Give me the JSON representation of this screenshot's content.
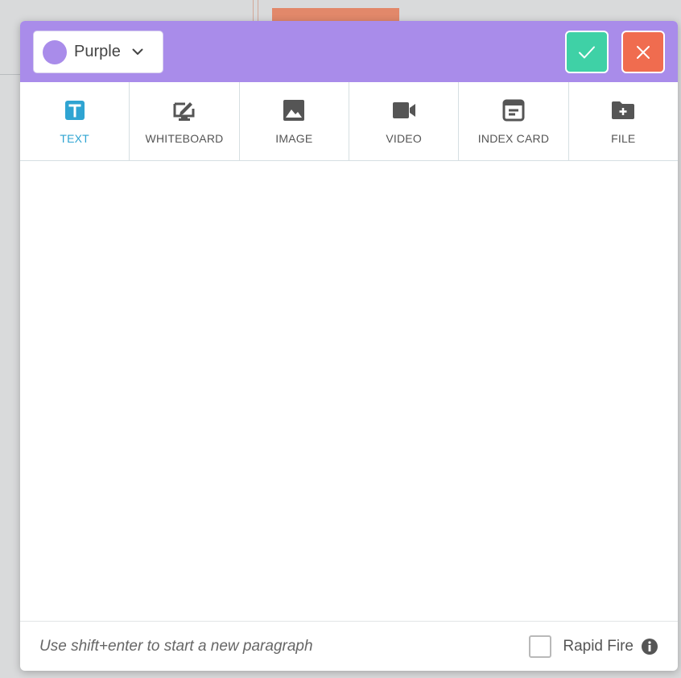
{
  "header": {
    "color_select": {
      "label": "Purple",
      "color": "#a98cea",
      "icon": "chevron-down-icon"
    },
    "confirm_button": {
      "icon": "check-icon",
      "color": "#3fd1a6"
    },
    "close_button": {
      "icon": "close-icon",
      "color": "#f06c4f"
    }
  },
  "toolbar": {
    "tools": [
      {
        "label": "TEXT",
        "icon": "text-icon",
        "active": true
      },
      {
        "label": "WHITEBOARD",
        "icon": "whiteboard-icon"
      },
      {
        "label": "IMAGE",
        "icon": "image-icon"
      },
      {
        "label": "VIDEO",
        "icon": "video-icon"
      },
      {
        "label": "INDEX CARD",
        "icon": "index-card-icon"
      },
      {
        "label": "FILE",
        "icon": "file-add-icon"
      }
    ],
    "active_color": "#2fa4d2"
  },
  "editor": {
    "value": ""
  },
  "footer": {
    "hint": "Use shift+enter to start a new paragraph",
    "rapid_fire_label": "Rapid Fire",
    "rapid_fire_checked": false,
    "info_icon": "info-icon"
  }
}
